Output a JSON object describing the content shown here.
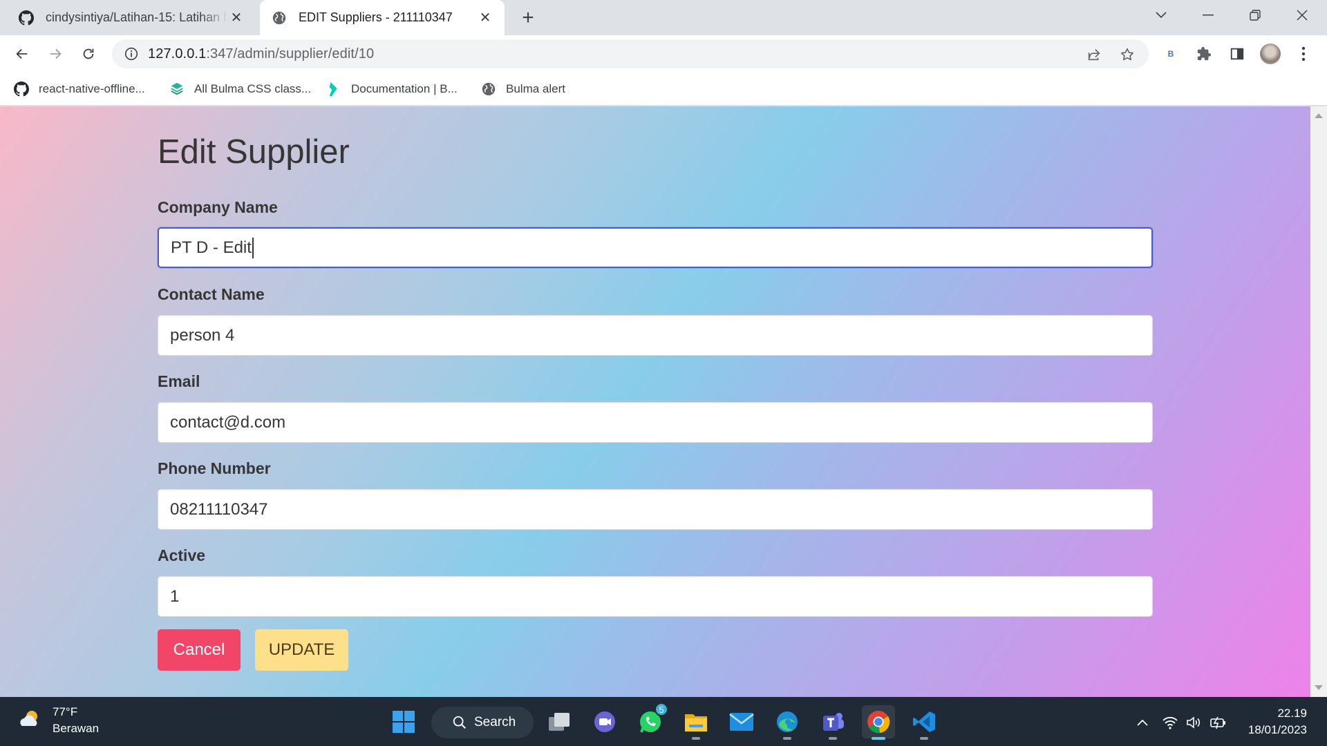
{
  "browser": {
    "tabs": [
      {
        "title": "cindysintiya/Latihan-15: Latihan h",
        "favicon": "github-icon"
      },
      {
        "title": "EDIT Suppliers - 211110347",
        "favicon": "globe-icon"
      }
    ],
    "url_host": "127.0.0.1",
    "url_path": ":347/admin/supplier/edit/10",
    "extension_badge": "B",
    "bookmarks": [
      {
        "label": "react-native-offline...",
        "icon": "github-icon"
      },
      {
        "label": "All Bulma CSS class...",
        "icon": "bulma-stack-icon"
      },
      {
        "label": "Documentation | B...",
        "icon": "bulma-logo-icon"
      },
      {
        "label": "Bulma alert",
        "icon": "globe-icon"
      }
    ]
  },
  "page": {
    "title": "Edit Supplier",
    "fields": [
      {
        "label": "Company Name",
        "value": "PT D - Edit"
      },
      {
        "label": "Contact Name",
        "value": "person 4"
      },
      {
        "label": "Email",
        "value": "contact@d.com"
      },
      {
        "label": "Phone Number",
        "value": "08211110347"
      },
      {
        "label": "Active",
        "value": "1"
      }
    ],
    "cancel_label": "Cancel",
    "update_label": "UPDATE",
    "colors": {
      "cancel": "#f14668",
      "update": "#ffe08a",
      "focus_border": "#485fc7"
    }
  },
  "taskbar": {
    "weather_temp": "77°F",
    "weather_desc": "Berawan",
    "search_label": "Search",
    "whatsapp_badge": "5",
    "time": "22.19",
    "date": "18/01/2023"
  }
}
